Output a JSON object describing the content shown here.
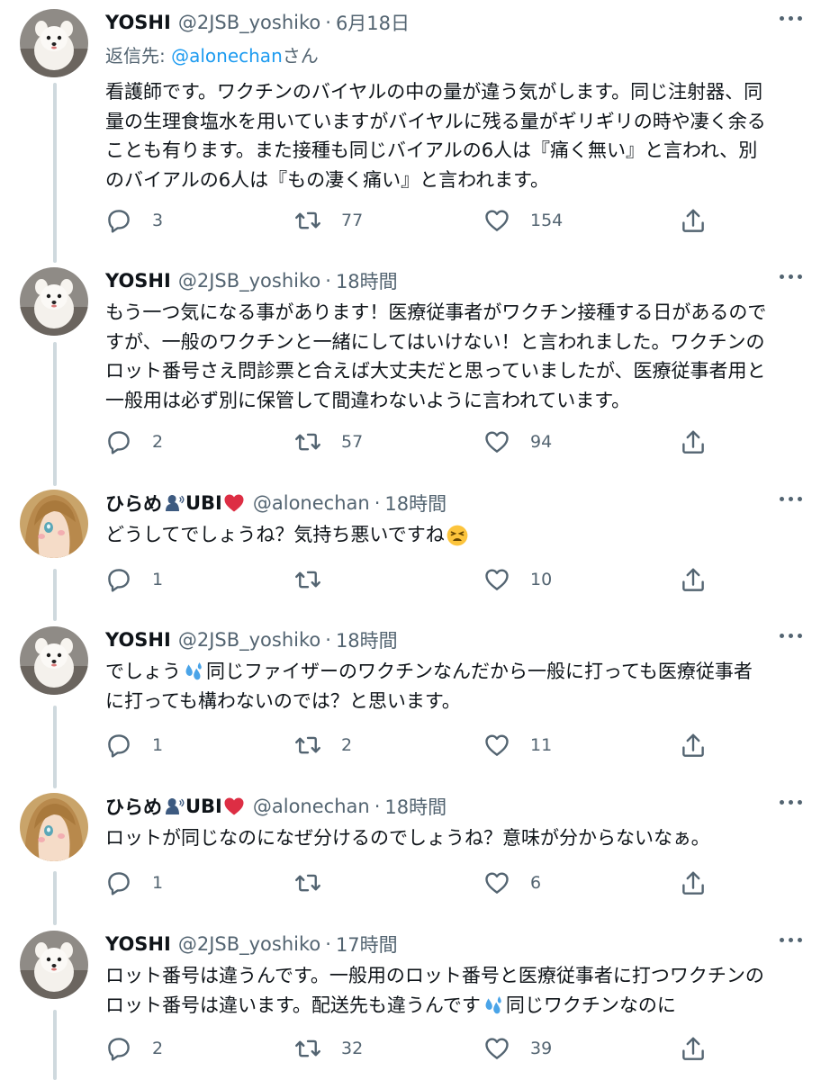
{
  "tweets": [
    {
      "name": "YOSHI",
      "handle": "@2JSB_yoshiko",
      "sep": "·",
      "time": "6月18日",
      "avatar": "pomeranian-avatar",
      "reply_prefix": "返信先: ",
      "reply_mention": "@alonechan",
      "reply_suffix": "さん",
      "lines": [
        "看護師です。ワクチンのバイヤルの中の量が違う気がします。同じ注射器、同",
        "量の生理食塩水を用いていますがバイヤルに残る量がギリギリの時や凄く余る",
        "ことも有ります。また接種も同じバイアルの6人は『痛く無い』と言われ、別",
        "のバイアルの6人は『もの凄く痛い』と言われます。"
      ],
      "replies": "3",
      "retweets": "77",
      "likes": "154"
    },
    {
      "name": "YOSHI",
      "handle": "@2JSB_yoshiko",
      "sep": "·",
      "time": "18時間",
      "avatar": "pomeranian-avatar",
      "lines": [
        "もう一つ気になる事があります！医療従事者がワクチン接種する日があるので",
        "すが、一般のワクチンと一緒にしてはいけない！と言われました。ワクチンの",
        "ロット番号さえ問診票と合えば大丈夫だと思っていましたが、医療従事者用と",
        "一般用は必ず別に保管して間違わないように言われています。"
      ],
      "replies": "2",
      "retweets": "57",
      "likes": "94"
    },
    {
      "name": "ひらめ",
      "name_suffix": "UBI",
      "handle": "@alonechan",
      "sep": "·",
      "time": "18時間",
      "avatar": "anime-girl-avatar",
      "name_emojis": [
        "speaking-head-icon",
        "red-heart-icon"
      ],
      "line_pre": "どうしてでしょうね？気持ち悪いですね",
      "line_emoji": "tired-face-icon",
      "replies": "1",
      "retweets": "",
      "likes": "10"
    },
    {
      "name": "YOSHI",
      "handle": "@2JSB_yoshiko",
      "sep": "·",
      "time": "18時間",
      "avatar": "pomeranian-avatar",
      "line1_pre": "でしょう",
      "line1_emoji": "sweat-droplets-icon",
      "line1_post": "同じファイザーのワクチンなんだから一般に打っても医療従事者",
      "line2": "に打っても構わないのでは？と思います。",
      "replies": "1",
      "retweets": "2",
      "likes": "11"
    },
    {
      "name": "ひらめ",
      "name_suffix": "UBI",
      "handle": "@alonechan",
      "sep": "·",
      "time": "18時間",
      "avatar": "anime-girl-avatar",
      "line": "ロットが同じなのになぜ分けるのでしょうね？意味が分からないなぁ。",
      "replies": "1",
      "retweets": "",
      "likes": "6"
    },
    {
      "name": "YOSHI",
      "handle": "@2JSB_yoshiko",
      "sep": "·",
      "time": "17時間",
      "avatar": "pomeranian-avatar",
      "line1": "ロット番号は違うんです。一般用のロット番号と医療従事者に打つワクチンの",
      "line2_pre": "ロット番号は違います。配送先も違うんです",
      "line2_emoji": "sweat-droplets-icon",
      "line2_post": "同じワクチンなのに",
      "replies": "2",
      "retweets": "32",
      "likes": "39"
    }
  ],
  "colors": {
    "text": "#0f1419",
    "secondary": "#536471",
    "link": "#1d9bf0",
    "thread_line": "#cfd9de"
  }
}
